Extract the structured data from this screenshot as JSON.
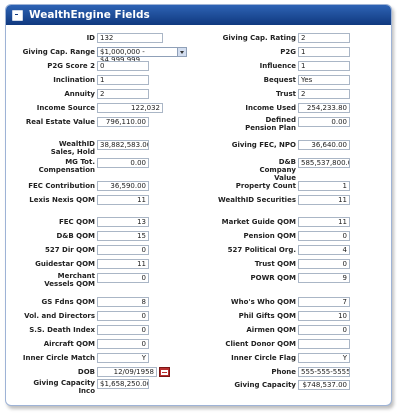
{
  "window": {
    "title": "WealthEngine Fields"
  },
  "fields": {
    "id": {
      "label": "ID",
      "value": "132"
    },
    "giving_cap_rating": {
      "label": "Giving Cap. Rating",
      "value": "2"
    },
    "giving_cap_range": {
      "label": "Giving Cap. Range",
      "value": "$1,000,000 - $4,999,999"
    },
    "p2g": {
      "label": "P2G",
      "value": "1"
    },
    "p2g_score2": {
      "label": "P2G Score 2",
      "value": "0"
    },
    "influence": {
      "label": "Influence",
      "value": "1"
    },
    "inclination": {
      "label": "Inclination",
      "value": "1"
    },
    "bequest": {
      "label": "Bequest",
      "value": "Yes"
    },
    "annuity": {
      "label": "Annuity",
      "value": "2"
    },
    "trust": {
      "label": "Trust",
      "value": "2"
    },
    "income_source": {
      "label": "Income Source",
      "value": "122,032"
    },
    "income_used": {
      "label": "Income Used",
      "value": "254,233.80"
    },
    "real_estate_value": {
      "label": "Real Estate Value",
      "value": "796,110.00"
    },
    "defined_pension_plan": {
      "label": "Defined Pension Plan",
      "value": "0.00"
    },
    "wealthid_sales_hold": {
      "label": "WealthID Sales, Hold",
      "value": "38,882,583.00"
    },
    "giving_fec_npo": {
      "label": "Giving FEC, NPO",
      "value": "36,640.00"
    },
    "mg_tot_compensation": {
      "label": "MG Tot. Compensation",
      "value": "0.00"
    },
    "db_company_value": {
      "label": "D&B Company Value",
      "value": "585,537,800.00"
    },
    "fec_contribution": {
      "label": "FEC Contribution",
      "value": "36,590.00"
    },
    "property_count": {
      "label": "Property Count",
      "value": "1"
    },
    "lexis_nexis_qom": {
      "label": "Lexis Nexis QOM",
      "value": "11"
    },
    "wealthid_securities": {
      "label": "WealthID Securities",
      "value": "11"
    },
    "fec_qom": {
      "label": "FEC QOM",
      "value": "13"
    },
    "market_guide_qom": {
      "label": "Market Guide QOM",
      "value": "11"
    },
    "db_qom": {
      "label": "D&B QOM",
      "value": "15"
    },
    "pension_qom": {
      "label": "Pension QOM",
      "value": "0"
    },
    "dir_527_qom": {
      "label": "527 Dir QOM",
      "value": "0"
    },
    "pol_org_527": {
      "label": "527 Political Org.",
      "value": "4"
    },
    "guidestar_qom": {
      "label": "Guidestar QOM",
      "value": "11"
    },
    "trust_qom": {
      "label": "Trust QOM",
      "value": "0"
    },
    "merchant_vessels_qom": {
      "label": "Merchant Vessels QOM",
      "value": "0"
    },
    "powr_qom": {
      "label": "POWR QOM",
      "value": "9"
    },
    "gs_fdns_qom": {
      "label": "GS Fdns QOM",
      "value": "8"
    },
    "whos_who_qom": {
      "label": "Who's Who QOM",
      "value": "7"
    },
    "vol_and_directors": {
      "label": "Vol. and Directors",
      "value": "0"
    },
    "phil_gifts_qom": {
      "label": "Phil Gifts QOM",
      "value": "10"
    },
    "ss_death_index": {
      "label": "S.S. Death Index",
      "value": "0"
    },
    "airmen_qom": {
      "label": "Airmen QOM",
      "value": "0"
    },
    "aircraft_qom": {
      "label": "Aircraft QOM",
      "value": "0"
    },
    "client_donor_qom": {
      "label": "Client Donor QOM",
      "value": ""
    },
    "inner_circle_match": {
      "label": "Inner Circle Match",
      "value": "Y"
    },
    "inner_circle_flag": {
      "label": "Inner Circle Flag",
      "value": "Y"
    },
    "dob": {
      "label": "DOB",
      "value": "12/09/1958"
    },
    "phone": {
      "label": "Phone",
      "value": "555-555-5555"
    },
    "giving_capacity_inco": {
      "label": "Giving Capacity Inco",
      "value": "$1,658,250.00"
    },
    "giving_capacity": {
      "label": "Giving Capacity",
      "value": "$748,537.00"
    }
  },
  "icons": {
    "titlebar": "window-icon",
    "dob_picker": "calendar-icon",
    "range_dropdown": "chevron-down-icon"
  }
}
